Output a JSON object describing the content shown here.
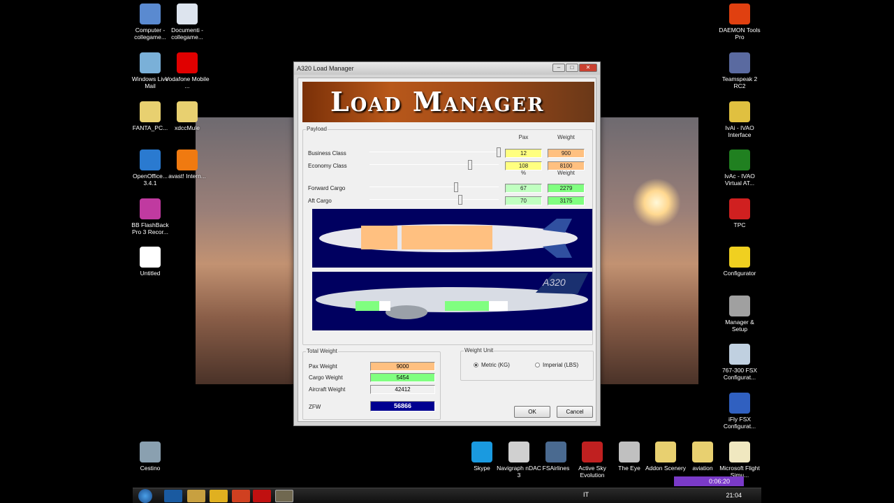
{
  "desktop_icons_left": [
    {
      "label": "Computer - collegame...",
      "color": "#5a8ad0"
    },
    {
      "label": "Documenti - collegame...",
      "color": "#dde4ee"
    },
    {
      "label": "Windows Live Mail",
      "color": "#7ab0d8"
    },
    {
      "label": "Vodafone Mobile ...",
      "color": "#e00000"
    },
    {
      "label": "FANTA_PC...",
      "color": "#e8d070"
    },
    {
      "label": "xdccMule",
      "color": "#e8d070"
    },
    {
      "label": "OpenOffice... 3.4.1",
      "color": "#2a7ad0"
    },
    {
      "label": "avast! Intern...",
      "color": "#f07a10"
    },
    {
      "label": "BB FlashBack Pro 3 Recor...",
      "color": "#c03aa0"
    },
    {
      "label": "Untitled",
      "color": "#ffffff"
    },
    {
      "label": "Cestino",
      "color": "#8aa0b0"
    }
  ],
  "desktop_icons_right": [
    {
      "label": "DAEMON Tools Pro",
      "color": "#e04010"
    },
    {
      "label": "Teamspeak 2 RC2",
      "color": "#5a6aa0"
    },
    {
      "label": "IvAi - IVAO Interface",
      "color": "#e0c040"
    },
    {
      "label": "IvAc - IVAO Virtual AT...",
      "color": "#208020"
    },
    {
      "label": "TPC",
      "color": "#d02020"
    },
    {
      "label": "Configurator",
      "color": "#f0d020"
    },
    {
      "label": "Manager & Setup",
      "color": "#a0a0a0"
    },
    {
      "label": "767-300 FSX Configurat...",
      "color": "#c0d0e0"
    },
    {
      "label": "iFly FSX Configurat...",
      "color": "#3060c0"
    }
  ],
  "desktop_icons_bottom": [
    {
      "label": "Skype",
      "color": "#1a9ae0"
    },
    {
      "label": "Navigraph nDAC 3",
      "color": "#d0d0d0"
    },
    {
      "label": "FSAirlines",
      "color": "#4a6a90"
    },
    {
      "label": "Active Sky Evolution",
      "color": "#c02020"
    },
    {
      "label": "The Eye",
      "color": "#c0c0c0"
    },
    {
      "label": "Addon Scenery",
      "color": "#e8d070"
    },
    {
      "label": "aviation",
      "color": "#e8d070"
    },
    {
      "label": "Microsoft Flight Simu...",
      "color": "#f0e8c0"
    }
  ],
  "taskbar": {
    "language": "IT",
    "clock": "21:04"
  },
  "recorder": {
    "time": "0:06:20"
  },
  "window": {
    "title": "A320 Load Manager",
    "banner": "Load Manager",
    "payload": {
      "legend": "Payload",
      "pax_header": "Pax",
      "weight_header": "Weight",
      "pct_header": "%",
      "weight_header2": "Weight",
      "rows": [
        {
          "label": "Business Class",
          "value": "12",
          "weight": "900",
          "slider_level": 1.0
        },
        {
          "label": "Economy Class",
          "value": "108",
          "weight": "8100",
          "slider_level": 0.78
        },
        {
          "label": "Forward Cargo",
          "value": "67",
          "weight": "2279",
          "slider_level": 0.67
        },
        {
          "label": "Aft Cargo",
          "value": "70",
          "weight": "3175",
          "slider_level": 0.7
        }
      ]
    },
    "total": {
      "legend": "Total Weight",
      "pax_label": "Pax Weight",
      "pax_value": "9000",
      "cargo_label": "Cargo Weight",
      "cargo_value": "5454",
      "aircraft_label": "Aircraft Weight",
      "aircraft_value": "42412",
      "zfw_label": "ZFW",
      "zfw_value": "56866"
    },
    "unit": {
      "legend": "Weight Unit",
      "metric": "Metric (KG)",
      "imperial": "Imperial (LBS)",
      "selected": "metric"
    },
    "ok": "OK",
    "cancel": "Cancel",
    "side_view_text": "A320"
  }
}
